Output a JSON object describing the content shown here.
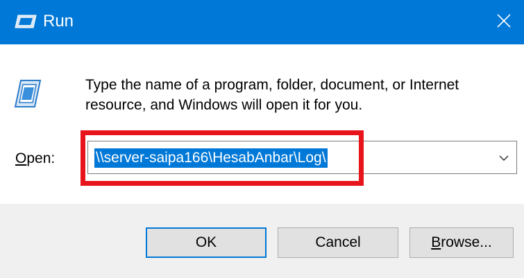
{
  "window": {
    "title": "Run",
    "close_glyph": "✕"
  },
  "icons": {
    "title_icon": "run-icon",
    "body_icon": "run-icon",
    "close": "close-icon",
    "dropdown": "chevron-down-icon"
  },
  "description": "Type the name of a program, folder, document, or Internet resource, and Windows will open it for you.",
  "open": {
    "label_accel": "O",
    "label_rest": "pen:",
    "value": "\\\\server-saipa166\\HesabAnbar\\Log\\"
  },
  "buttons": {
    "ok": "OK",
    "cancel": "Cancel",
    "browse_accel": "B",
    "browse_rest": "rowse..."
  },
  "colors": {
    "titlebar": "#0078d7",
    "selection": "#0078d7",
    "highlight": "#e8141c",
    "footer": "#f0f0f0"
  }
}
